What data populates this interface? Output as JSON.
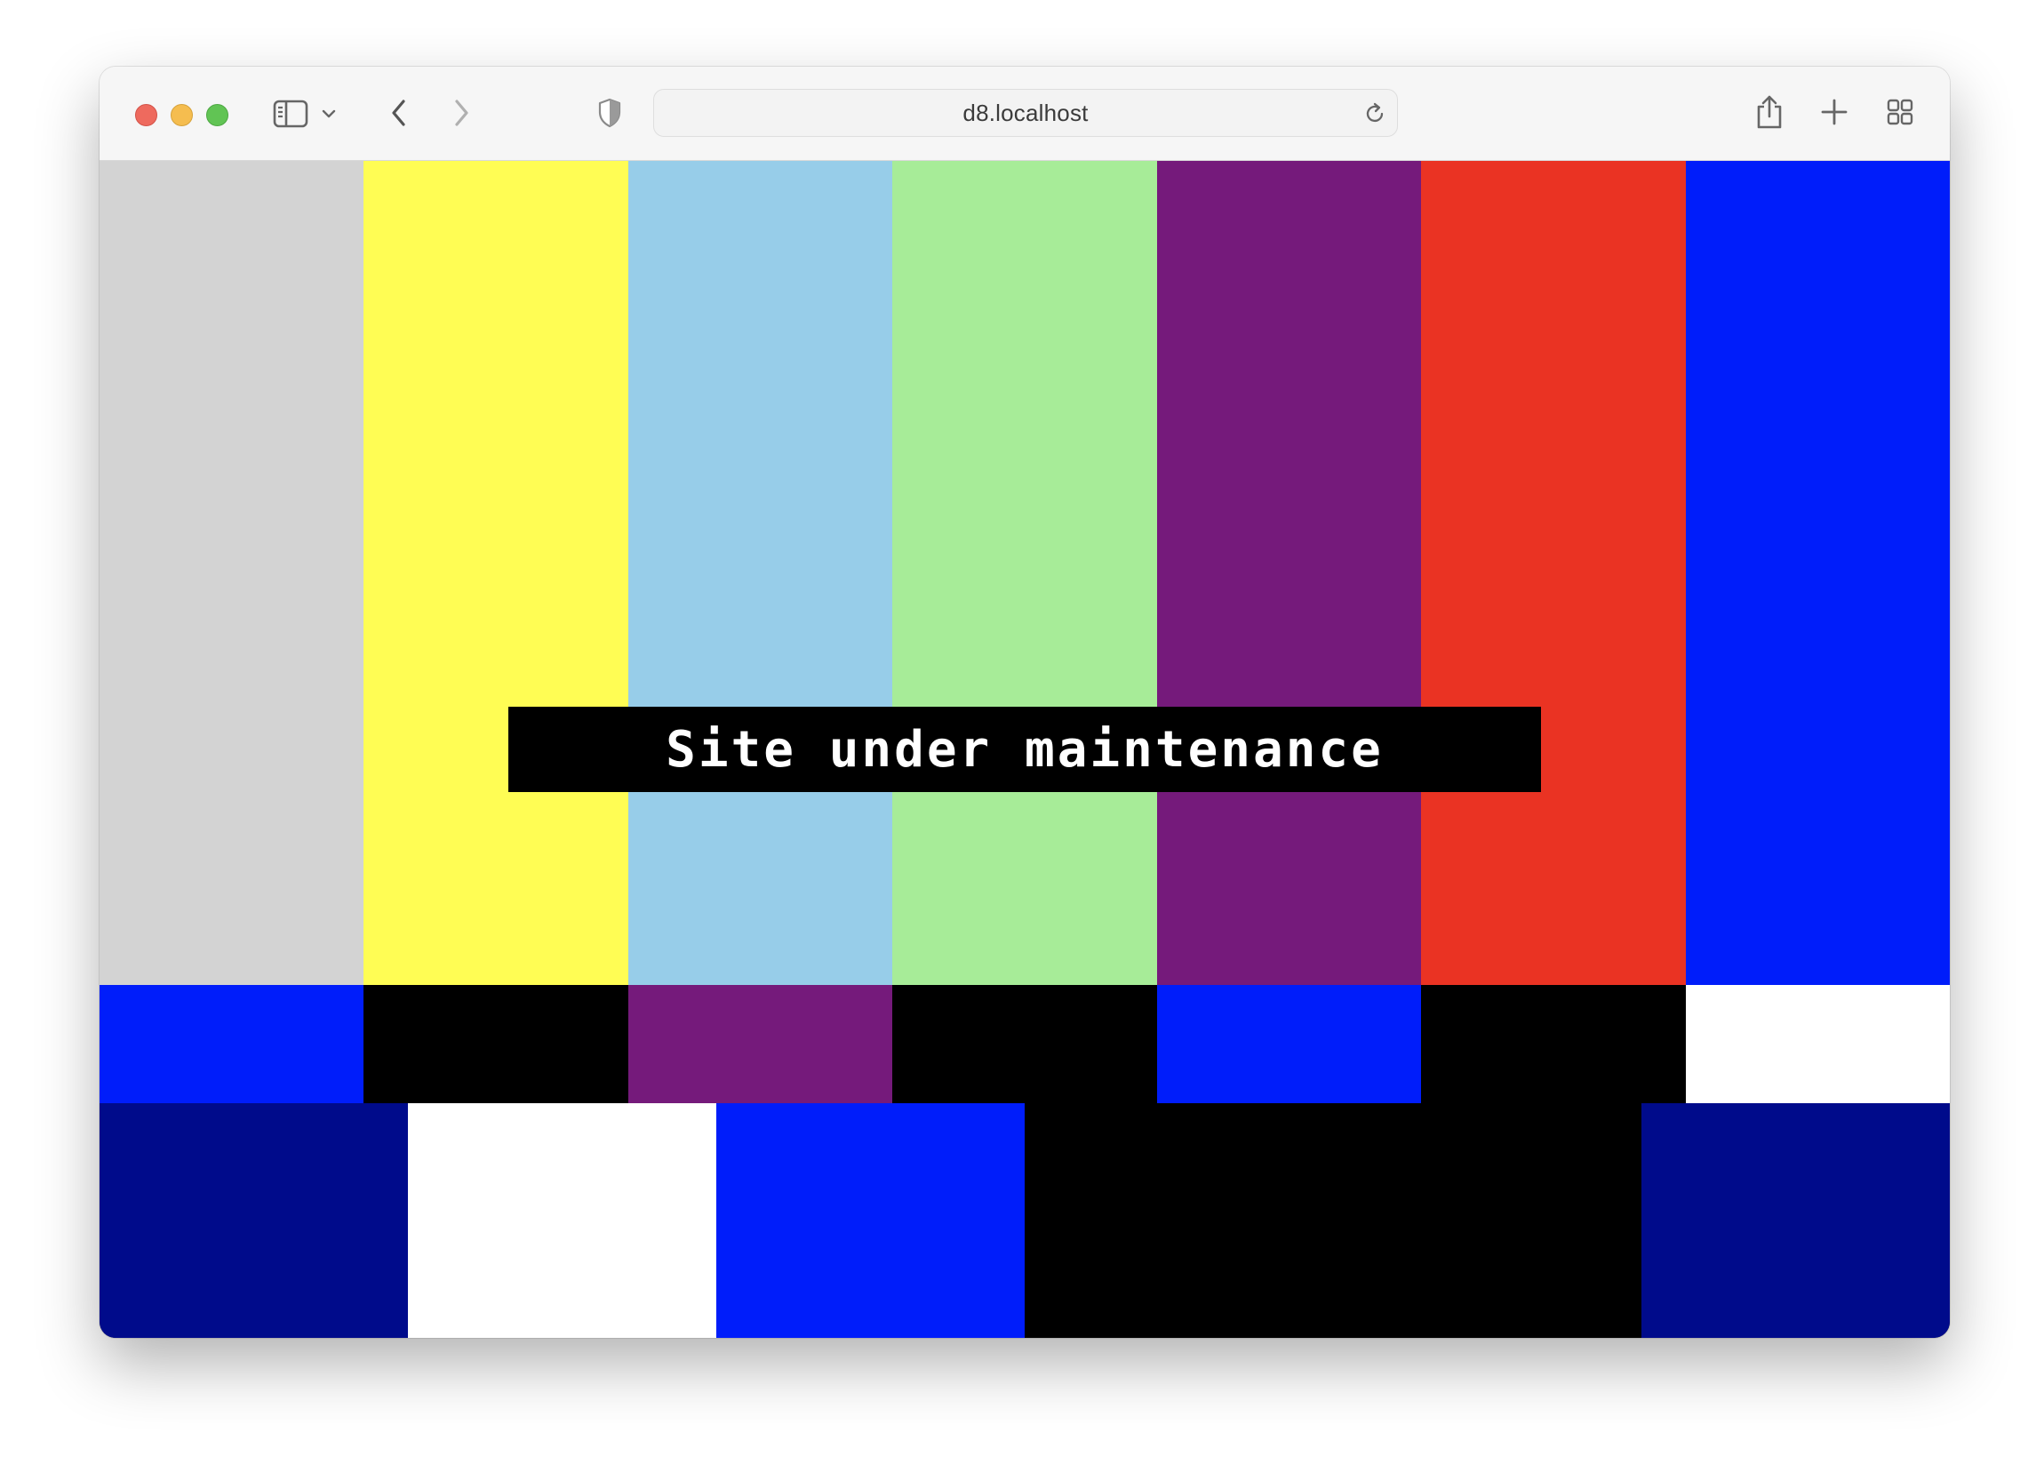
{
  "browser": {
    "url": "d8.localhost"
  },
  "page": {
    "message": "Site under maintenance"
  },
  "colors": {
    "gray": "#d3d3d3",
    "yellow": "#fffd54",
    "light_blue": "#97cde9",
    "light_green": "#a7ec98",
    "purple": "#751a7b",
    "red": "#ea3323",
    "blue": "#001dfa",
    "black": "#000000",
    "white": "#ffffff",
    "navy": "#000b8b"
  },
  "icons": {
    "sidebar": "sidebar-icon",
    "chevron": "chevron-down-icon",
    "back": "back-arrow-icon",
    "forward": "forward-arrow-icon",
    "privacy": "shield-icon",
    "reload": "reload-icon",
    "share": "share-icon",
    "new_tab": "plus-icon",
    "tab_overview": "grid-icon"
  }
}
